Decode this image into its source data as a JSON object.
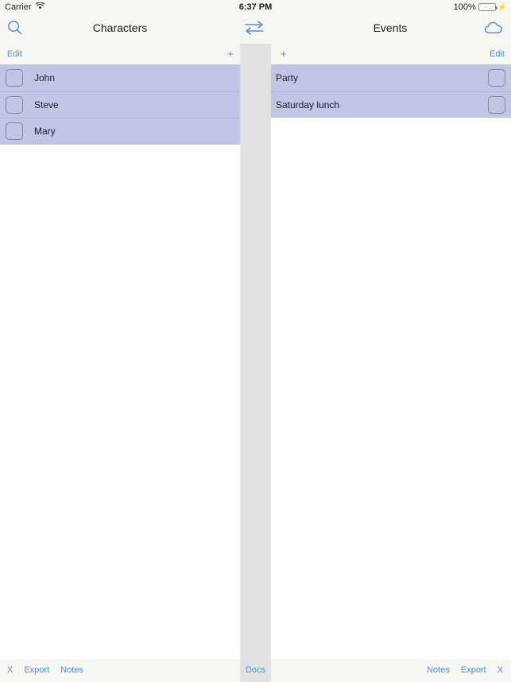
{
  "status_bar": {
    "carrier": "Carrier",
    "wifi_icon": "wifi-icon",
    "time": "6:37 PM",
    "battery_percent": "100%",
    "battery_icon": "battery-icon",
    "charging_icon": "lightning-bolt-icon",
    "battery_color": "#4cd964"
  },
  "nav": {
    "left_title": "Characters",
    "right_title": "Events",
    "search_icon": "search-icon",
    "swap_icon": "swap-arrows-icon",
    "cloud_icon": "cloud-icon",
    "accent_color": "#4a90f0"
  },
  "edit_bar": {
    "left_edit": "Edit",
    "left_add": "+",
    "right_add": "+",
    "right_edit": "Edit"
  },
  "left_panel": {
    "rows": [
      {
        "label": "John",
        "checked": false
      },
      {
        "label": "Steve",
        "checked": false
      },
      {
        "label": "Mary",
        "checked": false
      }
    ],
    "selected_color": "#c2c6e6"
  },
  "right_panel": {
    "rows": [
      {
        "label": "Party",
        "checked": false
      },
      {
        "label": "Saturday lunch",
        "checked": false
      }
    ],
    "selected_color": "#c2c6e6"
  },
  "divider": {
    "docs_label": "Docs",
    "color": "#e2e2e2"
  },
  "toolbar": {
    "left_buttons": [
      "X",
      "Export",
      "Notes"
    ],
    "right_buttons": [
      "Notes",
      "Export",
      "X"
    ]
  }
}
